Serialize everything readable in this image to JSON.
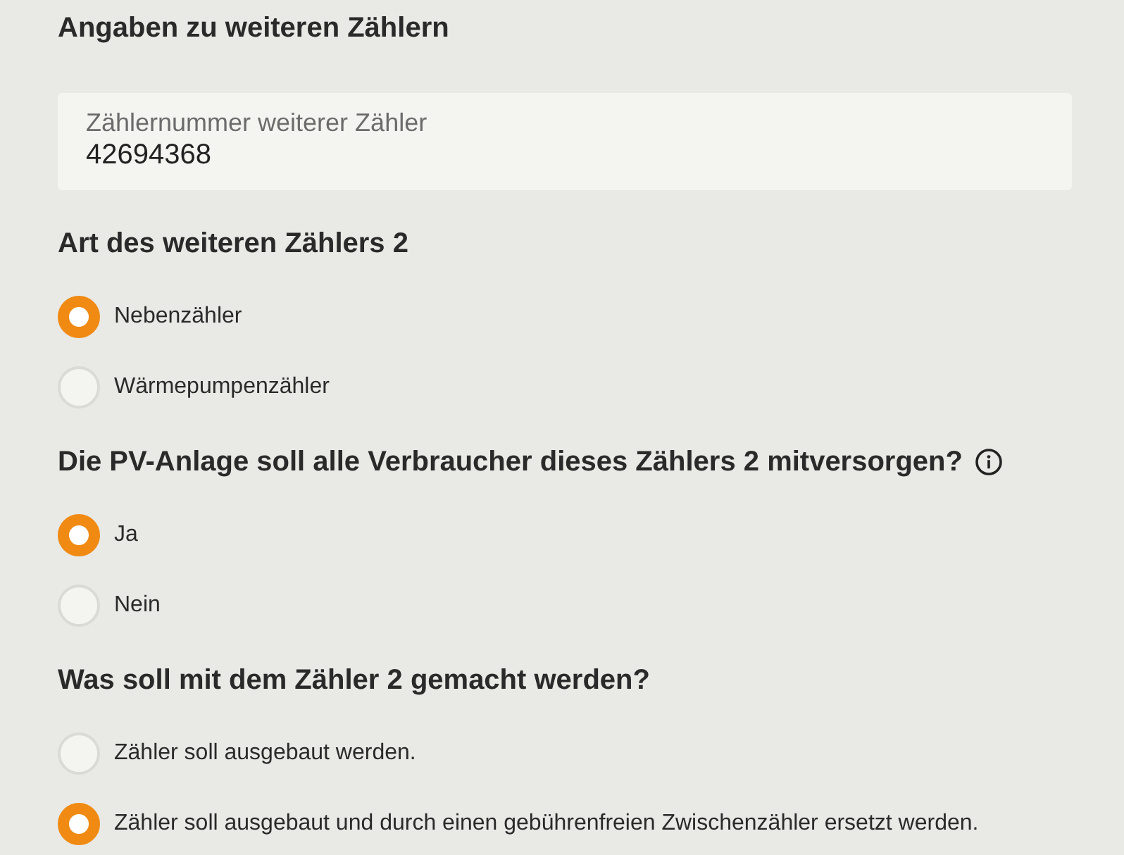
{
  "title": "Angaben zu weiteren Zählern",
  "meter_number": {
    "label": "Zählernummer weiterer Zähler",
    "value": "42694368"
  },
  "questions": [
    {
      "text": "Art des weiteren Zählers 2",
      "info": false,
      "options": [
        {
          "label": "Nebenzähler",
          "selected": true
        },
        {
          "label": "Wärmepumpenzähler",
          "selected": false
        }
      ]
    },
    {
      "text": "Die PV-Anlage soll alle Verbraucher dieses Zählers 2 mitversorgen?",
      "info": true,
      "options": [
        {
          "label": "Ja",
          "selected": true
        },
        {
          "label": "Nein",
          "selected": false
        }
      ]
    },
    {
      "text": "Was soll mit dem Zähler 2 gemacht werden?",
      "info": false,
      "options": [
        {
          "label": "Zähler soll ausgebaut werden.",
          "selected": false
        },
        {
          "label": "Zähler soll ausgebaut und durch einen gebührenfreien Zwischenzähler ersetzt werden.",
          "selected": true
        }
      ]
    }
  ]
}
